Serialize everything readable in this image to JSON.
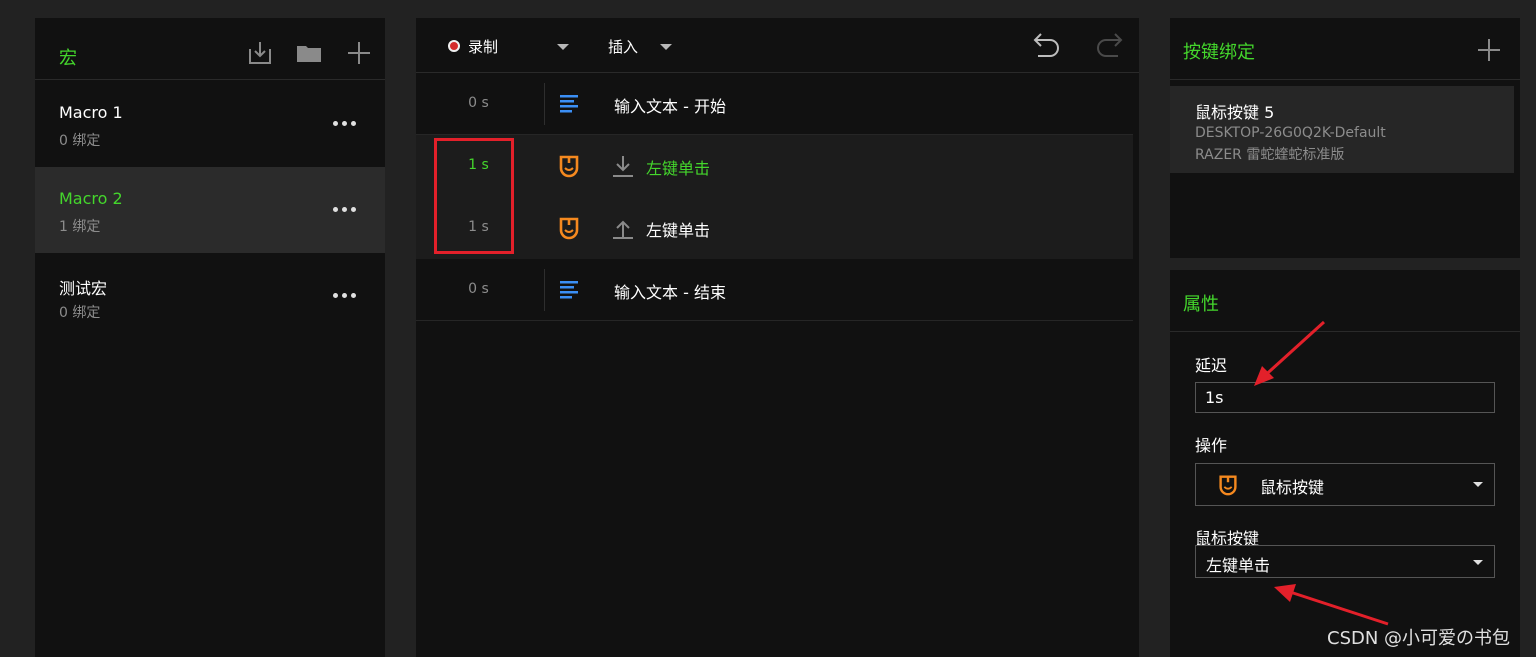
{
  "macros_panel": {
    "title": "宏",
    "items": [
      {
        "name": "Macro 1",
        "bindings": "0 绑定"
      },
      {
        "name": "Macro 2",
        "bindings": "1 绑定"
      },
      {
        "name": "测试宏",
        "bindings": "0 绑定"
      }
    ],
    "selected_index": 1
  },
  "editor": {
    "toolbar": {
      "record_label": "录制",
      "insert_label": "插入"
    },
    "steps": [
      {
        "delay": "0 s",
        "icon": "text-lines-icon",
        "action": "输入文本 - 开始"
      },
      {
        "delay": "1 s",
        "icon": "mouse-icon",
        "direction": "down",
        "action": "左键单击"
      },
      {
        "delay": "1 s",
        "icon": "mouse-icon",
        "direction": "up",
        "action": "左键单击"
      },
      {
        "delay": "0 s",
        "icon": "text-lines-icon",
        "action": "输入文本 - 结束"
      }
    ]
  },
  "key_binding": {
    "title": "按键绑定",
    "binding": {
      "key": "鼠标按键 5",
      "device": "DESKTOP-26G0Q2K-Default",
      "model": "RAZER 雷蛇蝰蛇标准版"
    }
  },
  "properties": {
    "title": "属性",
    "delay_label": "延迟",
    "delay_value": "1s",
    "action_label": "操作",
    "action_value": "鼠标按键",
    "mouse_button_label": "鼠标按键",
    "mouse_button_value": "左键单击"
  },
  "watermark": "CSDN @小可爱の书包",
  "colors": {
    "accent": "#44d62c",
    "mouse_icon": "#f5891f",
    "text_icon": "#3b8ff5",
    "annotation": "#e3202a"
  }
}
